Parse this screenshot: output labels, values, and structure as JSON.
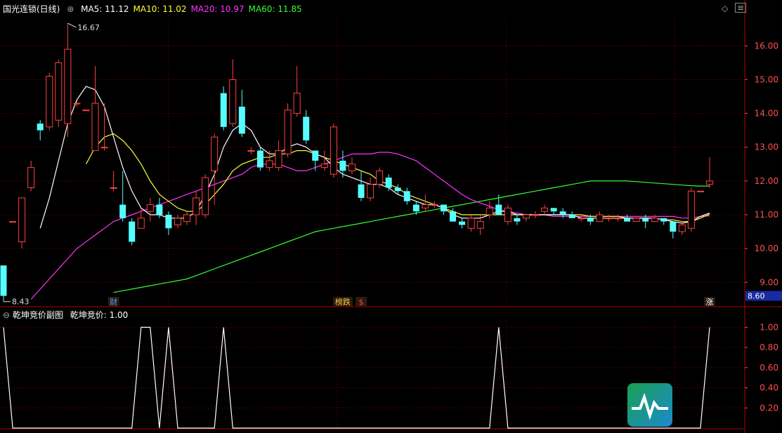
{
  "header": {
    "stock_name": "国光连锁(日线)",
    "ma_labels": [
      {
        "text": "MA5: 11.12",
        "color": "#ffffff"
      },
      {
        "text": "MA10: 11.02",
        "color": "#ffff33"
      },
      {
        "text": "MA20: 10.97",
        "color": "#ff33ff"
      },
      {
        "text": "MA60: 11.85",
        "color": "#33ff33"
      }
    ]
  },
  "sub_header": {
    "indicator_name": "乾坤竞价副图",
    "indicator_value": "乾坤竞价: 1.00"
  },
  "colors": {
    "up": "#ff4040",
    "down": "#55ffff",
    "grid": "#8b0000",
    "axis_text": "#ff5050",
    "divider": "#b00000",
    "price_tag": "#1a2aa0"
  },
  "chart_data": [
    {
      "type": "candlestick",
      "ylim": [
        8.3,
        16.9
      ],
      "y_ticks": [
        "9.00",
        "10.00",
        "11.00",
        "12.00",
        "13.00",
        "14.00",
        "15.00",
        "16.00"
      ],
      "price_tag": "8.60",
      "annotations": [
        {
          "index": 7,
          "text": "16.67",
          "kind": "high"
        },
        {
          "index": 0,
          "text": "8.43",
          "kind": "low"
        }
      ],
      "event_tags": [
        {
          "index": 12,
          "text": "财",
          "color": "#4aa0ff"
        },
        {
          "index": 37,
          "text": "榜跌",
          "color": "#ffcc44"
        },
        {
          "index": 39,
          "text": "$",
          "color": "#ff4040"
        },
        {
          "index": 77,
          "text": "涨",
          "color": "#ffffff"
        }
      ],
      "candles": [
        [
          9.5,
          8.6,
          9.5,
          8.43
        ],
        [
          10.8,
          10.8,
          10.8,
          10.8
        ],
        [
          10.2,
          11.5,
          11.5,
          10.0
        ],
        [
          11.8,
          12.4,
          12.6,
          11.7
        ],
        [
          13.7,
          13.5,
          13.8,
          13.2
        ],
        [
          13.6,
          15.1,
          15.2,
          13.5
        ],
        [
          13.8,
          15.5,
          15.6,
          13.6
        ],
        [
          13.7,
          15.9,
          16.67,
          13.3
        ],
        [
          14.3,
          14.3,
          14.35,
          14.2
        ],
        [
          14.1,
          14.1,
          14.1,
          14.1
        ],
        [
          12.9,
          14.3,
          15.4,
          12.9
        ],
        [
          13.0,
          13.0,
          14.3,
          12.9
        ],
        [
          11.8,
          11.8,
          12.3,
          11.7
        ],
        [
          11.3,
          10.9,
          12.3,
          10.8
        ],
        [
          10.8,
          10.2,
          10.9,
          10.1
        ],
        [
          10.6,
          10.9,
          11.2,
          10.6
        ],
        [
          11.1,
          11.3,
          11.5,
          10.8
        ],
        [
          11.3,
          11.0,
          11.5,
          10.9
        ],
        [
          11.0,
          10.6,
          11.1,
          10.4
        ],
        [
          10.7,
          10.9,
          11.0,
          10.6
        ],
        [
          10.8,
          11.0,
          11.1,
          10.7
        ],
        [
          11.0,
          11.5,
          11.7,
          10.7
        ],
        [
          11.0,
          12.1,
          12.2,
          10.9
        ],
        [
          12.3,
          13.3,
          13.4,
          11.3
        ],
        [
          14.6,
          13.6,
          14.8,
          13.5
        ],
        [
          13.7,
          15.0,
          15.6,
          13.6
        ],
        [
          14.2,
          13.4,
          14.7,
          13.3
        ],
        [
          12.9,
          12.9,
          13.0,
          12.8
        ],
        [
          12.9,
          12.4,
          13.0,
          12.3
        ],
        [
          12.4,
          12.6,
          12.9,
          12.3
        ],
        [
          12.4,
          12.9,
          13.2,
          12.3
        ],
        [
          12.8,
          14.1,
          14.3,
          12.7
        ],
        [
          14.0,
          14.6,
          15.4,
          13.9
        ],
        [
          13.9,
          13.2,
          14.1,
          13.1
        ],
        [
          12.9,
          12.6,
          12.9,
          12.3
        ],
        [
          12.4,
          12.5,
          12.9,
          12.3
        ],
        [
          12.2,
          13.6,
          13.7,
          12.1
        ],
        [
          12.6,
          12.3,
          12.9,
          12.1
        ],
        [
          12.3,
          12.5,
          12.7,
          12.2
        ],
        [
          11.9,
          11.5,
          12.3,
          11.4
        ],
        [
          11.5,
          11.9,
          12.1,
          11.4
        ],
        [
          11.9,
          12.3,
          12.4,
          11.8
        ],
        [
          12.1,
          11.8,
          12.2,
          11.7
        ],
        [
          11.8,
          11.7,
          11.9,
          11.6
        ],
        [
          11.7,
          11.4,
          11.8,
          11.3
        ],
        [
          11.3,
          11.1,
          11.4,
          11.0
        ],
        [
          11.2,
          11.3,
          11.6,
          11.1
        ],
        [
          11.3,
          11.3,
          11.4,
          11.2
        ],
        [
          11.3,
          11.1,
          11.3,
          11.0
        ],
        [
          11.1,
          10.8,
          11.2,
          10.8
        ],
        [
          10.8,
          10.7,
          10.9,
          10.6
        ],
        [
          10.6,
          10.9,
          11.0,
          10.5
        ],
        [
          10.6,
          10.8,
          11.0,
          10.4
        ],
        [
          11.0,
          11.2,
          11.4,
          10.9
        ],
        [
          11.3,
          11.0,
          11.6,
          11.0
        ],
        [
          10.8,
          11.2,
          11.3,
          10.7
        ],
        [
          10.9,
          10.8,
          11.0,
          10.7
        ],
        [
          10.9,
          11.0,
          11.0,
          10.8
        ],
        [
          11.0,
          11.0,
          11.1,
          10.9
        ],
        [
          11.1,
          11.2,
          11.3,
          11.0
        ],
        [
          11.2,
          11.1,
          11.2,
          11.0
        ],
        [
          11.1,
          11.0,
          11.2,
          10.9
        ],
        [
          11.0,
          10.9,
          11.1,
          10.9
        ],
        [
          10.9,
          10.9,
          11.0,
          10.8
        ],
        [
          10.9,
          10.8,
          11.0,
          10.7
        ],
        [
          10.8,
          11.0,
          11.1,
          10.8
        ],
        [
          10.9,
          10.9,
          11.0,
          10.8
        ],
        [
          10.9,
          10.9,
          11.0,
          10.8
        ],
        [
          10.9,
          10.8,
          11.0,
          10.8
        ],
        [
          10.8,
          10.9,
          10.9,
          10.8
        ],
        [
          10.9,
          10.8,
          11.0,
          10.6
        ],
        [
          10.8,
          10.9,
          11.0,
          10.8
        ],
        [
          10.9,
          10.8,
          10.9,
          10.7
        ],
        [
          10.8,
          10.5,
          10.8,
          10.3
        ],
        [
          10.5,
          10.7,
          10.8,
          10.4
        ],
        [
          10.6,
          11.7,
          11.8,
          10.5
        ],
        [
          11.7,
          11.7,
          11.7,
          11.7
        ],
        [
          11.9,
          12.0,
          12.7,
          11.8
        ]
      ],
      "ma5": [
        null,
        null,
        null,
        null,
        10.6,
        11.5,
        12.6,
        13.7,
        14.4,
        14.8,
        14.7,
        14.2,
        13.3,
        12.4,
        11.7,
        11.2,
        11.0,
        11.0,
        10.9,
        10.9,
        10.9,
        11.1,
        11.6,
        12.2,
        13.0,
        13.5,
        13.7,
        13.5,
        13.0,
        12.8,
        12.8,
        13.0,
        13.1,
        13.0,
        12.8,
        12.7,
        12.4,
        12.2,
        12.1,
        12.0,
        11.9,
        11.9,
        11.8,
        11.6,
        11.5,
        11.4,
        11.3,
        11.3,
        11.2,
        11.0,
        10.9,
        10.9,
        10.9,
        11.0,
        11.1,
        11.1,
        11.0,
        11.0,
        11.0,
        11.0,
        11.0,
        11.0,
        11.0,
        10.9,
        10.9,
        10.9,
        10.9,
        10.9,
        10.9,
        10.9,
        10.9,
        10.9,
        10.85,
        10.8,
        10.75,
        10.8,
        10.95,
        11.05
      ],
      "ma10": [
        null,
        null,
        null,
        null,
        null,
        null,
        null,
        null,
        null,
        12.5,
        13.0,
        13.3,
        13.4,
        13.2,
        12.9,
        12.5,
        12.0,
        11.6,
        11.4,
        11.2,
        11.1,
        11.1,
        11.3,
        11.6,
        11.9,
        12.3,
        12.5,
        12.6,
        12.7,
        12.7,
        12.8,
        12.8,
        12.9,
        12.9,
        12.8,
        12.7,
        12.6,
        12.5,
        12.4,
        12.3,
        12.2,
        12.0,
        11.9,
        11.8,
        11.6,
        11.5,
        11.4,
        11.3,
        11.2,
        11.1,
        11.0,
        11.0,
        11.0,
        11.0,
        11.0,
        11.0,
        11.0,
        11.0,
        11.0,
        11.0,
        11.0,
        11.0,
        11.0,
        11.0,
        10.95,
        10.95,
        10.95,
        10.95,
        10.9,
        10.9,
        10.9,
        10.9,
        10.85,
        10.85,
        10.8,
        10.8,
        10.9,
        11.02
      ],
      "ma20": [
        null,
        null,
        null,
        8.5,
        8.8,
        9.1,
        9.4,
        9.7,
        10.0,
        10.2,
        10.4,
        10.6,
        10.8,
        10.9,
        11.0,
        11.1,
        11.2,
        11.3,
        11.4,
        11.5,
        11.6,
        11.7,
        11.8,
        11.9,
        12.0,
        12.1,
        12.2,
        12.4,
        12.5,
        12.5,
        12.5,
        12.4,
        12.3,
        12.3,
        12.4,
        12.5,
        12.6,
        12.7,
        12.8,
        12.8,
        12.8,
        12.85,
        12.85,
        12.8,
        12.7,
        12.6,
        12.4,
        12.2,
        12.0,
        11.8,
        11.6,
        11.45,
        11.35,
        11.25,
        11.15,
        11.1,
        11.05,
        11.0,
        11.0,
        11.0,
        10.95,
        10.95,
        10.95,
        10.95,
        10.95,
        10.95,
        10.95,
        10.95,
        10.95,
        10.95,
        10.95,
        10.95,
        10.95,
        10.95,
        10.9,
        10.9,
        10.95,
        10.97
      ],
      "ma60": [
        null,
        null,
        null,
        null,
        null,
        null,
        null,
        null,
        null,
        null,
        null,
        null,
        8.7,
        8.75,
        8.8,
        8.85,
        8.9,
        8.95,
        9.0,
        9.05,
        9.1,
        9.2,
        9.3,
        9.4,
        9.5,
        9.6,
        9.7,
        9.8,
        9.9,
        10.0,
        10.1,
        10.2,
        10.3,
        10.4,
        10.5,
        10.55,
        10.6,
        10.65,
        10.7,
        10.75,
        10.8,
        10.85,
        10.9,
        10.95,
        11.0,
        11.05,
        11.1,
        11.15,
        11.2,
        11.25,
        11.3,
        11.35,
        11.4,
        11.45,
        11.5,
        11.55,
        11.6,
        11.65,
        11.7,
        11.75,
        11.8,
        11.85,
        11.9,
        11.95,
        12.0,
        12.0,
        12.0,
        12.0,
        12.0,
        11.98,
        11.96,
        11.94,
        11.92,
        11.9,
        11.88,
        11.86,
        11.85,
        11.85
      ]
    },
    {
      "type": "line",
      "name": "乾坤竞价",
      "ylim": [
        0,
        1.1
      ],
      "y_ticks": [
        "0.20",
        "0.40",
        "0.60",
        "0.80",
        "1.00"
      ],
      "values": [
        1,
        0,
        0,
        0,
        0,
        0,
        0,
        0,
        0,
        0,
        0,
        0,
        0,
        0,
        0,
        1,
        1,
        0,
        1,
        0,
        0,
        0,
        0,
        0,
        1,
        0,
        0,
        0,
        0,
        0,
        0,
        0,
        0,
        0,
        0,
        0,
        0,
        0,
        0,
        0,
        0,
        0,
        0,
        0,
        0,
        0,
        0,
        0,
        0,
        0,
        0,
        0,
        0,
        0,
        1,
        0,
        0,
        0,
        0,
        0,
        0,
        0,
        0,
        0,
        0,
        0,
        0,
        0,
        0,
        0,
        0,
        0,
        0,
        0,
        0,
        0,
        0,
        1
      ]
    }
  ]
}
